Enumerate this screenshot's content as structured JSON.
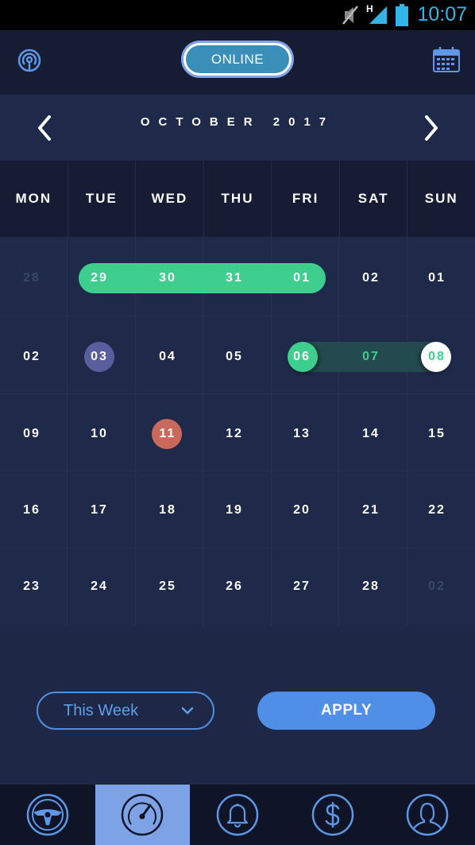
{
  "status_bar": {
    "time": "10:07",
    "network": "H",
    "icons": [
      "mute-icon",
      "signal-icon",
      "battery-icon"
    ]
  },
  "header": {
    "status_button": "ONLINE",
    "left_icon": "broadcast-icon",
    "right_icon": "calendar-icon"
  },
  "calendar": {
    "month_label": "OCTOBER 2017",
    "prev_icon": "chevron-left-icon",
    "next_icon": "chevron-right-icon",
    "weekdays": [
      "MON",
      "TUE",
      "WED",
      "THU",
      "FRI",
      "SAT",
      "SUN"
    ],
    "weeks": [
      [
        "28",
        "29",
        "30",
        "31",
        "01",
        "02",
        "01"
      ],
      [
        "02",
        "03",
        "04",
        "05",
        "06",
        "07",
        "08"
      ],
      [
        "09",
        "10",
        "11",
        "12",
        "13",
        "14",
        "15"
      ],
      [
        "16",
        "17",
        "18",
        "19",
        "20",
        "21",
        "22"
      ],
      [
        "23",
        "24",
        "25",
        "26",
        "27",
        "28",
        "02"
      ]
    ],
    "colors": {
      "range_green": "#3ecf8e",
      "range_dark": "#234a4e",
      "selected_purple": "#5b5e9e",
      "today_red": "#c8695c",
      "muted": "#3a4666"
    }
  },
  "filters": {
    "period_selected": "This Week",
    "apply_label": "APPLY"
  },
  "tabbar": {
    "items": [
      "steering-wheel-icon",
      "speedometer-icon",
      "bell-icon",
      "dollar-icon",
      "user-icon"
    ],
    "active_index": 1
  }
}
